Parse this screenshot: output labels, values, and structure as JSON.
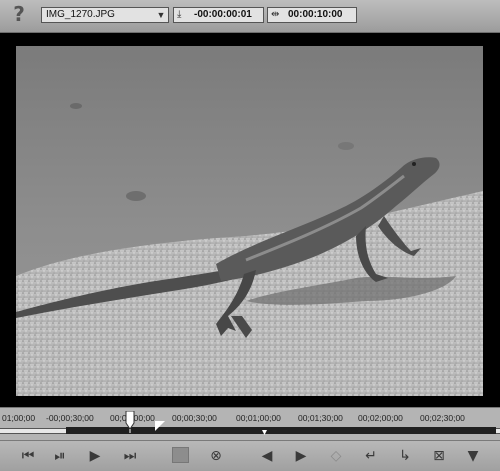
{
  "toolbar": {
    "help_icon": "question-icon",
    "clip_name": "IMG_1270.JPG",
    "in_timecode": "-00:00:00:01",
    "duration_timecode": "00:00:10:00"
  },
  "preview": {
    "content": "lizard-photo"
  },
  "timeline": {
    "labels": [
      "01;00;00",
      "-00;00;30;00",
      "00;00;00;00",
      "00;00;30;00",
      "00;01;00;00",
      "00;01;30;00",
      "00;02;00;00",
      "00;02;30;00"
    ]
  },
  "transport": {
    "buttons": [
      "go-to-start-icon",
      "step-back-icon",
      "play-icon",
      "go-to-end-icon",
      "stop-icon",
      "loop-icon",
      "mark-in-icon",
      "mark-out-icon",
      "split-icon",
      "insert-icon",
      "overwrite-icon",
      "fit-icon",
      "export-icon"
    ]
  },
  "colors": {
    "background": "#a8a8a8",
    "preview_bg": "#000000",
    "range_bar": "#202020"
  }
}
